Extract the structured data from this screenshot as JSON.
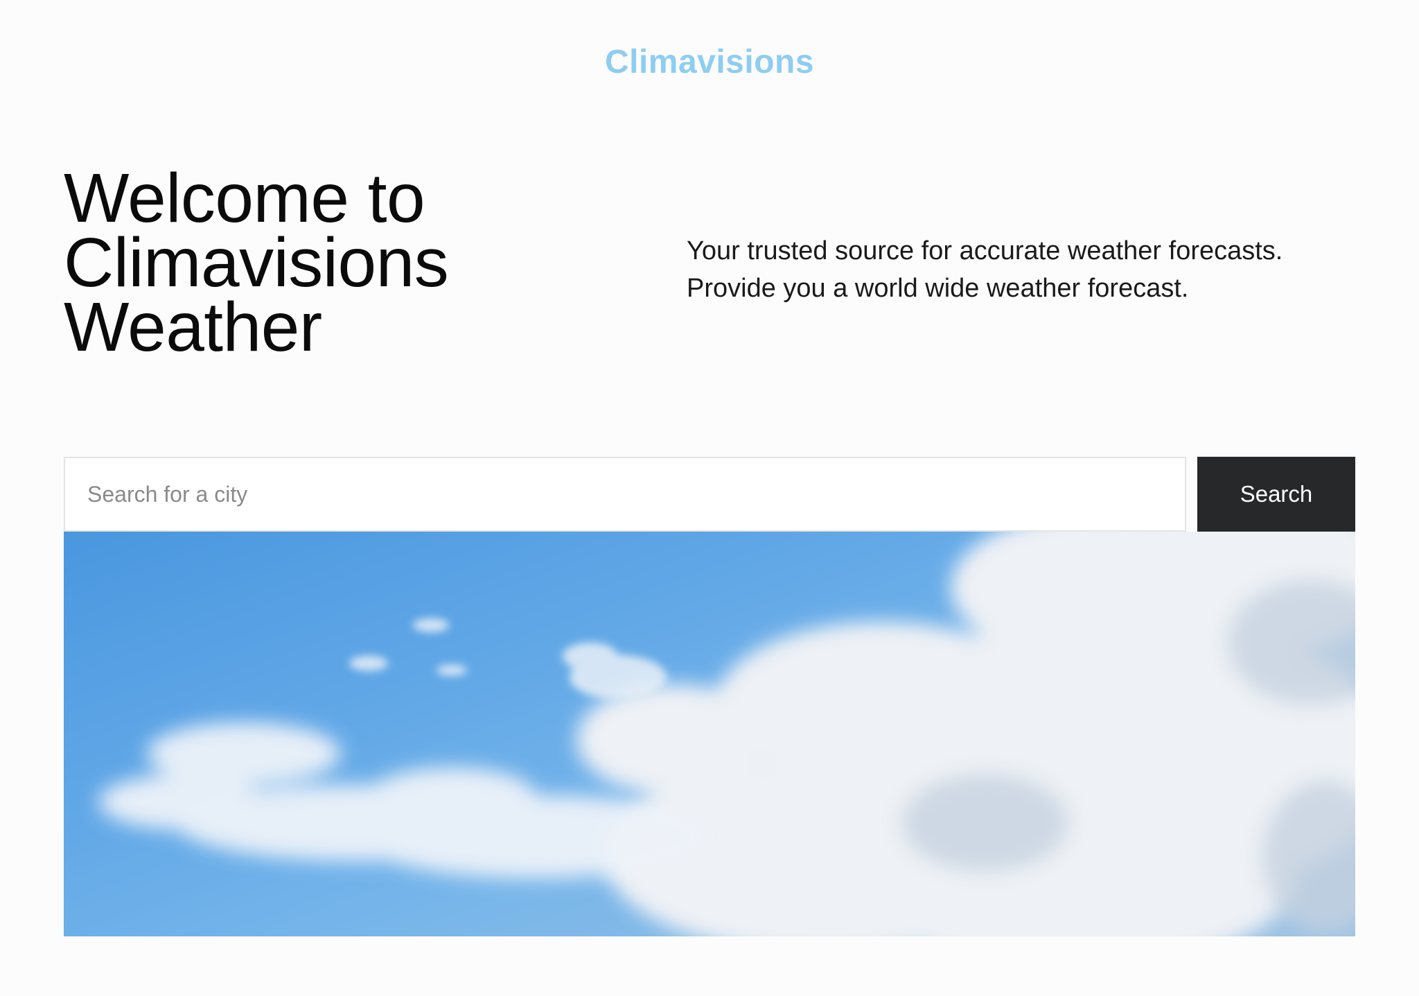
{
  "header": {
    "brand": "Climavisions"
  },
  "hero": {
    "title_lines": [
      "Welcome to",
      "Climavisions",
      "Weather"
    ],
    "tagline_lines": [
      "Your trusted source for accurate weather forecasts.",
      "Provide you a world wide weather forecast."
    ]
  },
  "search": {
    "placeholder": "Search for a city",
    "value": "",
    "button_label": "Search"
  },
  "banner": {
    "icon": "sky-clouds-image"
  },
  "colors": {
    "brand": "#8ecdf2",
    "button_bg": "#27282a",
    "page_bg": "#fcfcfc"
  }
}
